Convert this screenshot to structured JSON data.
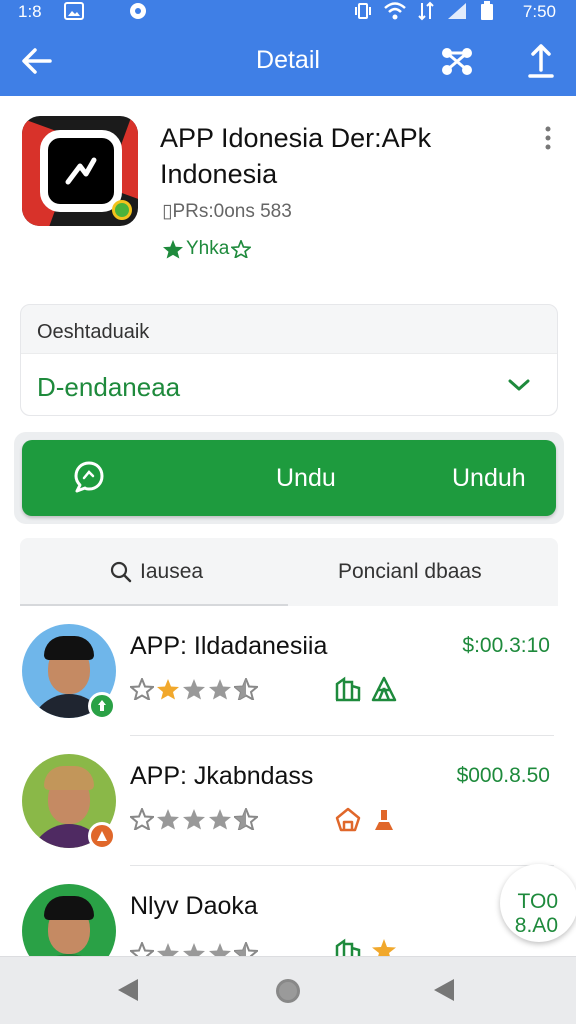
{
  "status_bar": {
    "time_left": "1:8",
    "time_right": "7:50"
  },
  "app_bar": {
    "title": "Detail"
  },
  "app": {
    "title": "APP Idonesia Der:APk Indonesia",
    "meta": "▯PRs:0ons 583",
    "rating_text": "Yhka"
  },
  "select": {
    "label": "Oeshtaduaik",
    "value": "D-endaneaa"
  },
  "download_button": {
    "label_primary": "Undu",
    "label_secondary": "Unduh"
  },
  "tabs": [
    {
      "label": "Iausea",
      "icon": "search-icon"
    },
    {
      "label": "Poncianl dbaas"
    }
  ],
  "list": [
    {
      "name": "APP: Ildadanesiia",
      "price": "$:00.3:10",
      "rating": 3.5,
      "badge_color": "#2aa146",
      "shirt_color": "#1f2530",
      "bg_color": "#6fb6ea",
      "hair_color": "#111111"
    },
    {
      "name": "APP: Jkabndass",
      "price": "$000.8.50",
      "rating": 3.5,
      "badge_color": "#e0672a",
      "shirt_color": "#4f2a62",
      "bg_color": "#8ab848",
      "hair_color": "#c2965a"
    },
    {
      "name": "Nlyv Daoka",
      "price": "TO0 8.A0",
      "rating": 3.5,
      "badge_color": "#2aa146",
      "shirt_color": "#1d7f3a",
      "bg_color": "#2aa146",
      "hair_color": "#111111"
    }
  ],
  "colors": {
    "primary": "#3f7fe6",
    "accent_green": "#1e9b3e",
    "star": "#f1a82c"
  }
}
